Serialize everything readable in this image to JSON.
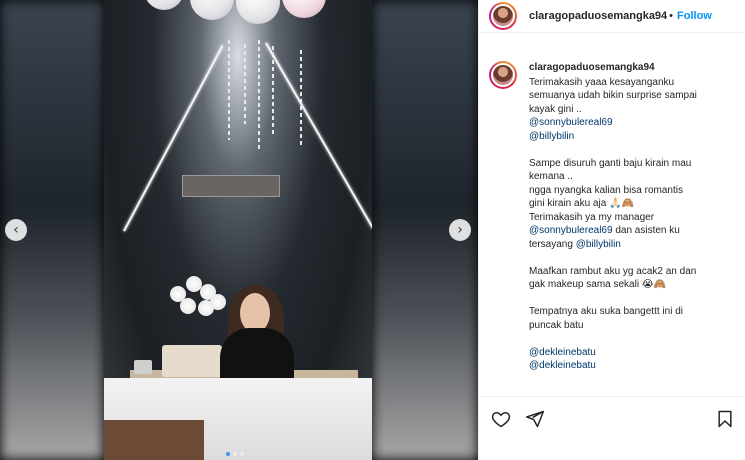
{
  "post": {
    "username": "claragopaduosemangka94",
    "follow_separator": "•",
    "follow_label": "Follow"
  },
  "caption": {
    "username": "claragopaduosemangka94",
    "lines": [
      {
        "text": "Terimakasih yaaa kesayanganku",
        "type": "text"
      },
      {
        "text": "semuanya udah bikin surprise sampai",
        "type": "text"
      },
      {
        "text": "kayak gini ..",
        "type": "text"
      },
      {
        "text": "@sonnybulereal69",
        "type": "mention"
      },
      {
        "text": "@billybilin",
        "type": "mention"
      },
      {
        "text": "",
        "type": "gap"
      },
      {
        "text": "Sampe disuruh ganti baju kirain mau",
        "type": "text"
      },
      {
        "text": "kemana ..",
        "type": "text"
      },
      {
        "text": "ngga nyangka kalian bisa romantis",
        "type": "text"
      },
      {
        "text": "gini kirain aku aja 🙏🏻🙈",
        "type": "text"
      },
      {
        "text": "Terimakasih ya my manager",
        "type": "text"
      },
      {
        "text": "@sonnybulereal69 dan asisten ku",
        "type": "mixed",
        "mention": "@sonnybulereal69",
        "rest": " dan asisten ku"
      },
      {
        "text": "tersayang @billybilin",
        "type": "mixed-end",
        "prefix": "tersayang ",
        "mention": "@billybilin"
      },
      {
        "text": "",
        "type": "gap"
      },
      {
        "text": "Maafkan rambut aku yg acak2 an dan",
        "type": "text"
      },
      {
        "text": "gak makeup sama sekali 😭🙈",
        "type": "text"
      },
      {
        "text": "",
        "type": "gap"
      },
      {
        "text": "Tempatnya aku suka bangettt ini di",
        "type": "text"
      },
      {
        "text": "puncak batu",
        "type": "text"
      },
      {
        "text": "",
        "type": "gap"
      },
      {
        "text": "@dekleinebatu",
        "type": "mention"
      },
      {
        "text": "@dekleinebatu",
        "type": "mention"
      }
    ]
  },
  "carousel": {
    "prev_icon": "‹",
    "next_icon": "›",
    "slide_count": 3,
    "active_slide": 1
  },
  "icons": {
    "like": "heart-icon",
    "share": "share-icon",
    "save": "bookmark-icon"
  },
  "colors": {
    "follow": "#0095f6",
    "mention": "#00376b",
    "active_dot": "#3897f0"
  }
}
